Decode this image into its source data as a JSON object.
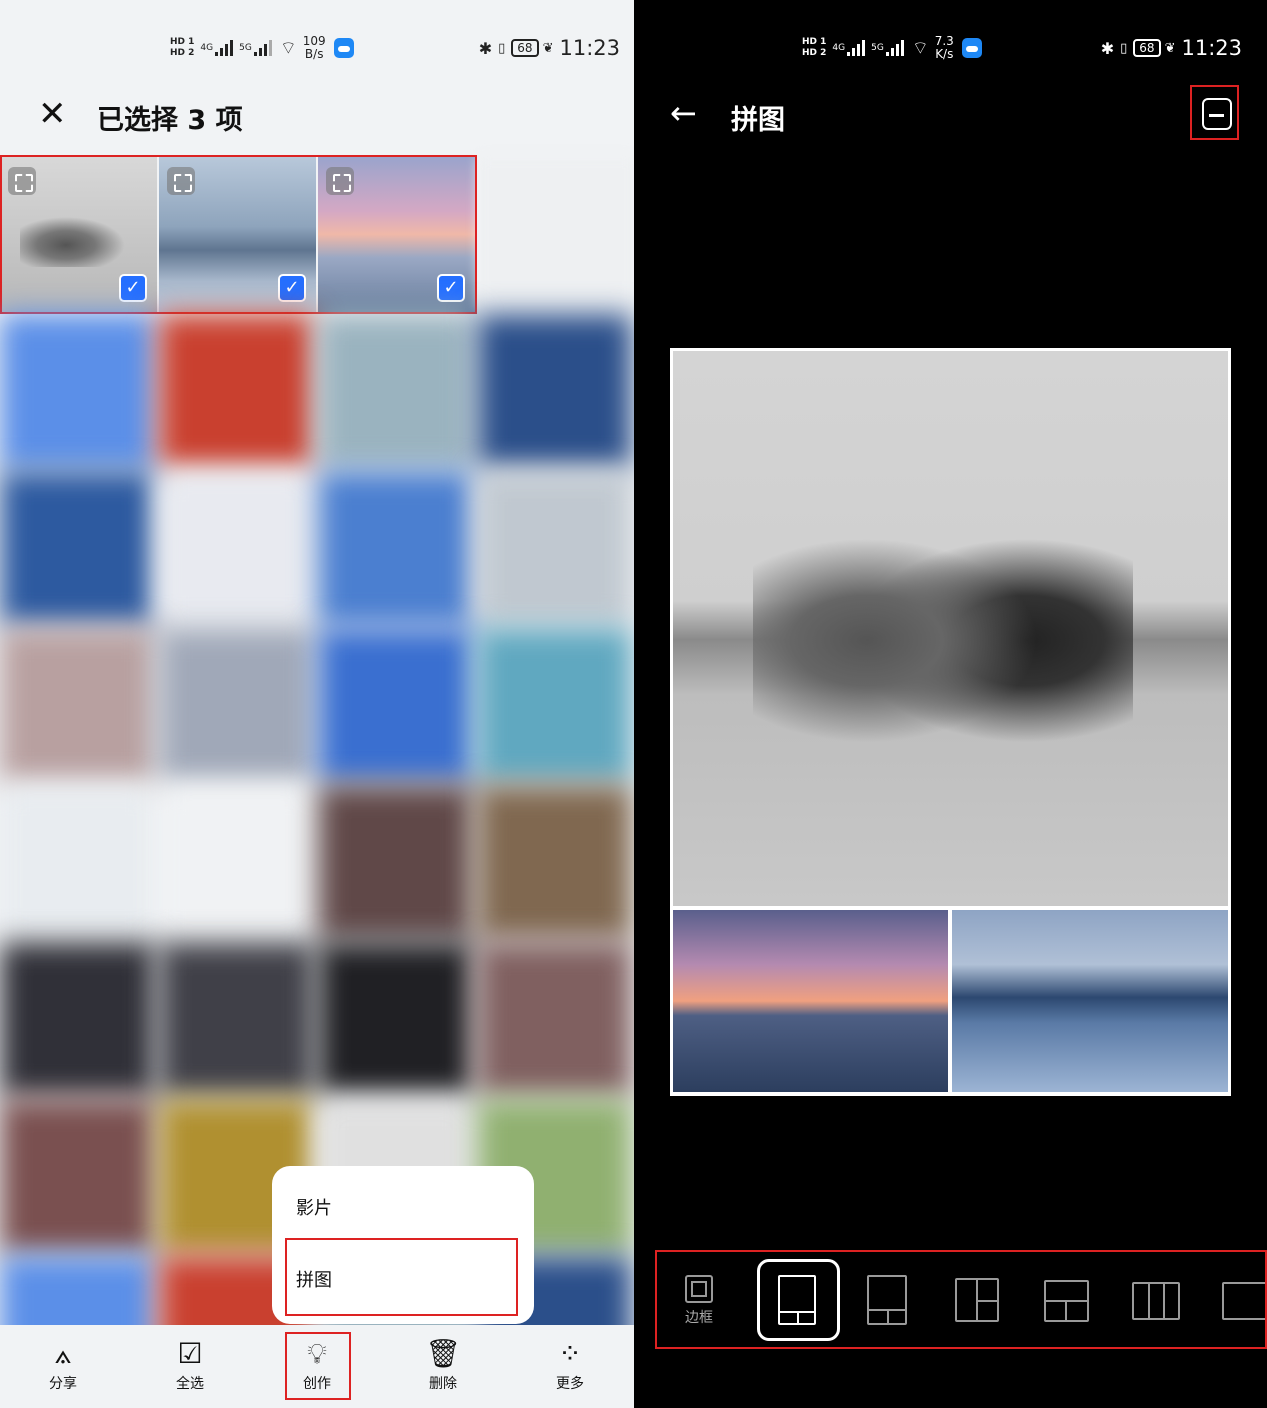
{
  "left": {
    "status": {
      "hd1": "HD 1",
      "hd2": "HD 2",
      "net1": "4G",
      "net2": "5G",
      "speed_value": "109",
      "speed_unit": "B/s",
      "battery": "68",
      "time": "11:23"
    },
    "header": {
      "title": "已选择 3 项"
    },
    "selected_count": 3,
    "popup_menu": {
      "items": [
        {
          "label": "影片"
        },
        {
          "label": "拼图"
        }
      ]
    },
    "toolbar": {
      "items": [
        {
          "label": "分享",
          "icon": "share-icon"
        },
        {
          "label": "全选",
          "icon": "select-all-icon"
        },
        {
          "label": "创作",
          "icon": "lightbulb-icon"
        },
        {
          "label": "删除",
          "icon": "trash-icon"
        },
        {
          "label": "更多",
          "icon": "more-icon"
        }
      ]
    }
  },
  "right": {
    "status": {
      "hd1": "HD 1",
      "hd2": "HD 2",
      "net1": "4G",
      "net2": "5G",
      "speed_value": "7.3",
      "speed_unit": "K/s",
      "battery": "68",
      "time": "11:23"
    },
    "header": {
      "title": "拼图"
    },
    "layout_bar": {
      "border_label": "边框",
      "selected_index": 0
    }
  },
  "colors": {
    "accent": "#256fff",
    "highlight": "#d22222"
  }
}
